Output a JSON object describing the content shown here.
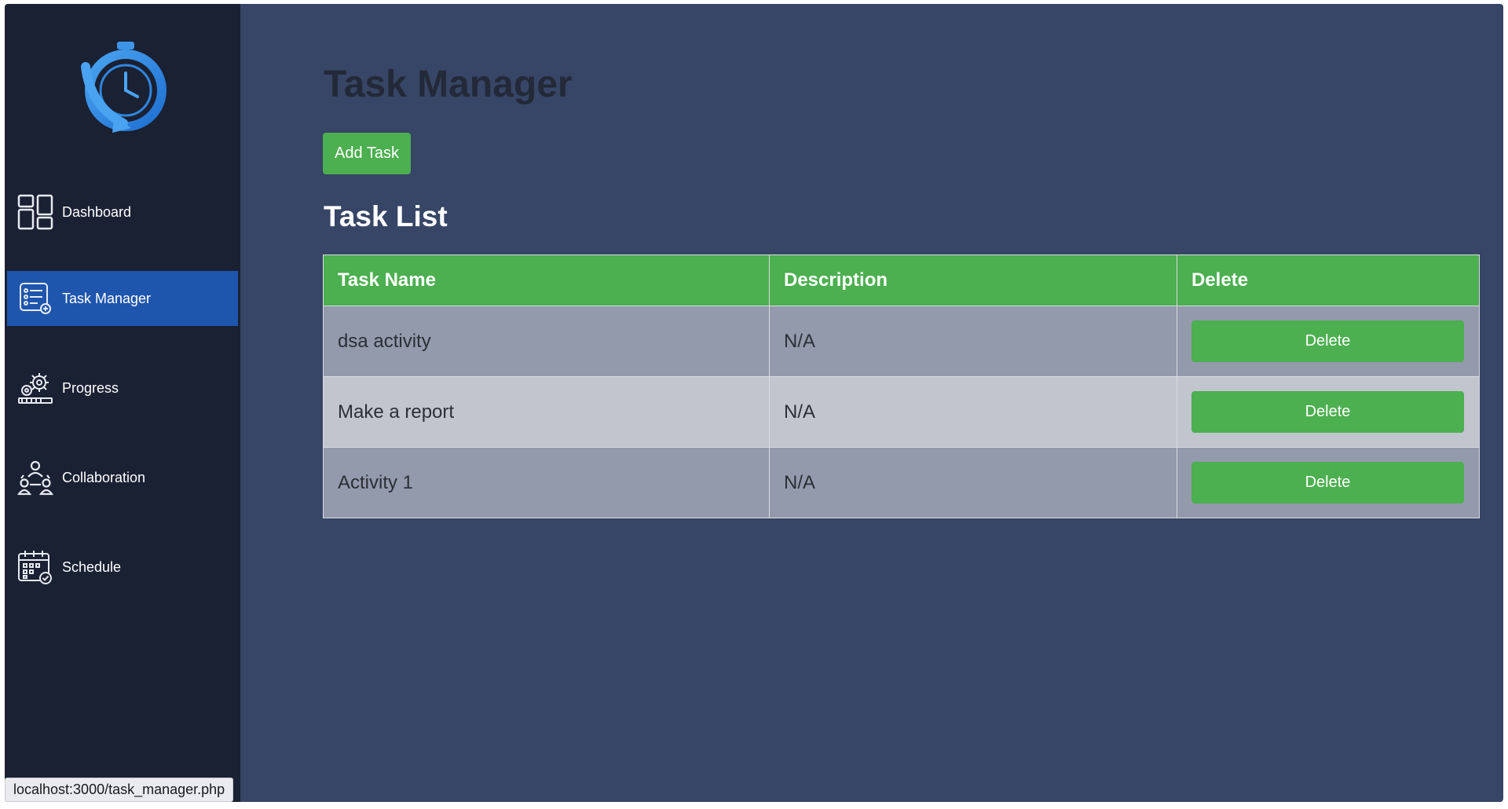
{
  "sidebar": {
    "logo_icon": "stopwatch-logo-icon",
    "items": [
      {
        "label": "Dashboard",
        "icon": "dashboard-grid-icon",
        "active": false
      },
      {
        "label": "Task Manager",
        "icon": "task-list-icon",
        "active": true
      },
      {
        "label": "Progress",
        "icon": "gears-progress-icon",
        "active": false
      },
      {
        "label": "Collaboration",
        "icon": "team-users-icon",
        "active": false
      },
      {
        "label": "Schedule",
        "icon": "calendar-check-icon",
        "active": false
      }
    ]
  },
  "main": {
    "title": "Task Manager",
    "add_button_label": "Add Task",
    "list_title": "Task List",
    "table": {
      "headers": [
        "Task Name",
        "Description",
        "Delete"
      ],
      "rows": [
        {
          "name": "dsa activity",
          "description": "N/A",
          "action": "Delete"
        },
        {
          "name": "Make a report",
          "description": "N/A",
          "action": "Delete"
        },
        {
          "name": "Activity 1",
          "description": "N/A",
          "action": "Delete"
        }
      ]
    }
  },
  "status_bar": {
    "url": "localhost:3000/task_manager.php"
  },
  "colors": {
    "sidebar_bg": "#1a2133",
    "main_bg": "#374566",
    "active_nav": "#1f56ad",
    "accent_green": "#4caf50",
    "row_dark": "#939aab",
    "row_light": "#c1c5ce"
  }
}
